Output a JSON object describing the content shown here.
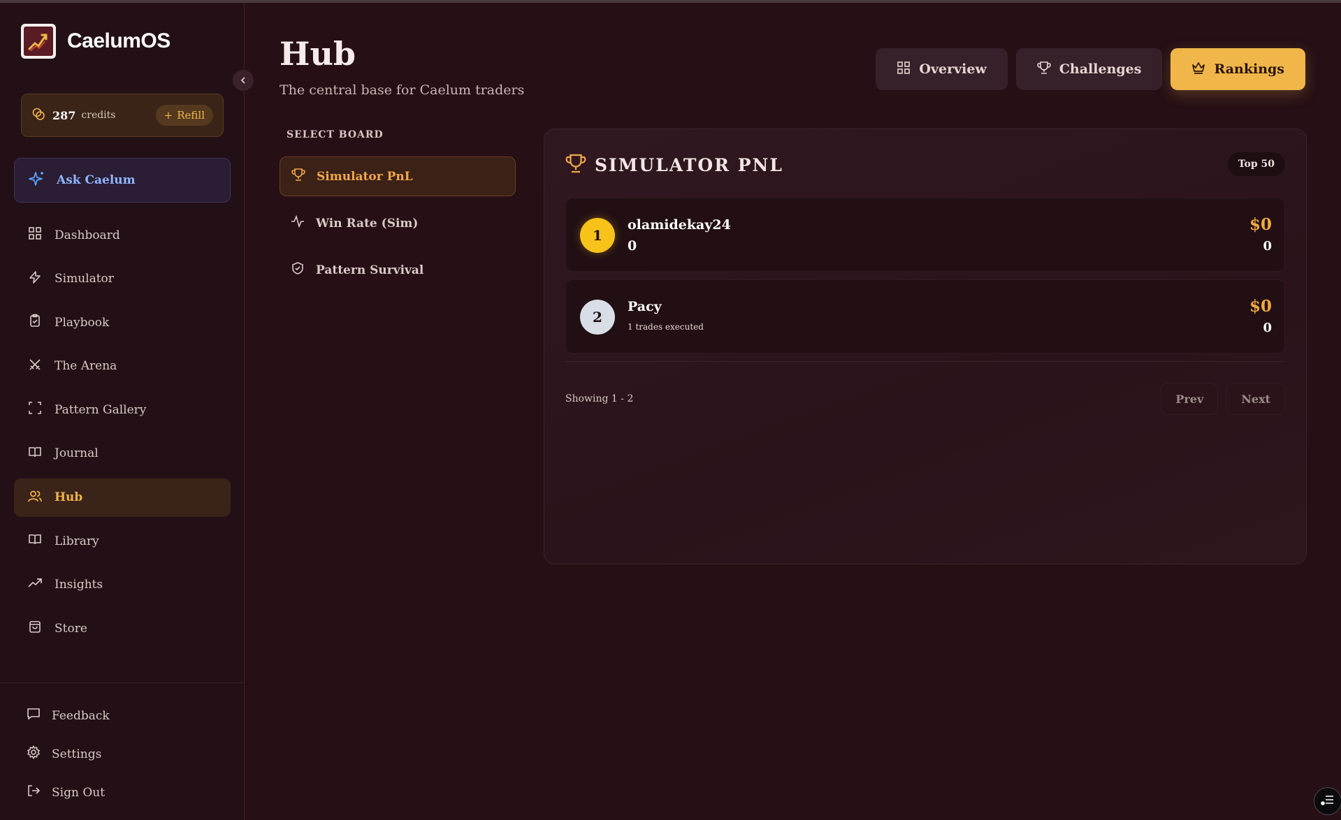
{
  "app": {
    "name": "CaelumOS",
    "logo_icon": "chart-up-arrow-icon"
  },
  "sidebar": {
    "credits": {
      "value": "287",
      "label": "credits",
      "refill_label": "Refill"
    },
    "ask_label": "Ask Caelum",
    "items": [
      {
        "label": "Dashboard",
        "icon": "grid-icon"
      },
      {
        "label": "Simulator",
        "icon": "lightning-icon"
      },
      {
        "label": "Playbook",
        "icon": "clipboard-icon"
      },
      {
        "label": "The Arena",
        "icon": "crossed-swords-icon"
      },
      {
        "label": "Pattern Gallery",
        "icon": "scan-frame-icon"
      },
      {
        "label": "Journal",
        "icon": "book-icon"
      },
      {
        "label": "Hub",
        "icon": "users-icon",
        "active": true
      },
      {
        "label": "Library",
        "icon": "book-open-icon"
      },
      {
        "label": "Insights",
        "icon": "trending-up-icon"
      },
      {
        "label": "Store",
        "icon": "shopping-bag-icon"
      }
    ],
    "bottom": [
      {
        "label": "Feedback",
        "icon": "message-icon"
      },
      {
        "label": "Settings",
        "icon": "gear-icon"
      },
      {
        "label": "Sign Out",
        "icon": "sign-out-icon"
      }
    ]
  },
  "header": {
    "title": "Hub",
    "subtitle": "The central base for Caelum traders",
    "tabs": [
      {
        "label": "Overview",
        "icon": "grid-icon"
      },
      {
        "label": "Challenges",
        "icon": "trophy-icon"
      },
      {
        "label": "Rankings",
        "icon": "crown-icon",
        "active": true
      }
    ]
  },
  "boards": {
    "label": "SELECT BOARD",
    "items": [
      {
        "label": "Simulator PnL",
        "icon": "trophy-icon",
        "active": true
      },
      {
        "label": "Win Rate (Sim)",
        "icon": "activity-icon"
      },
      {
        "label": "Pattern Survival",
        "icon": "shield-icon"
      }
    ]
  },
  "leaderboard": {
    "title": "SIMULATOR PNL",
    "badge": "Top 50",
    "rows": [
      {
        "rank": "1",
        "name": "olamidekay24",
        "sub": "0",
        "pnl": "$0",
        "value": "0"
      },
      {
        "rank": "2",
        "name": "Pacy",
        "sub": "1 trades executed",
        "pnl": "$0",
        "value": "0"
      }
    ],
    "showing": "Showing 1 - 2",
    "prev_label": "Prev",
    "next_label": "Next"
  },
  "colors": {
    "accent": "#f0b64a",
    "background": "#260f15",
    "sidebar": "#231016",
    "gold_rank": "#f7c21a",
    "silver_rank": "#d9dde6",
    "ask_text": "#8fb6ff"
  }
}
